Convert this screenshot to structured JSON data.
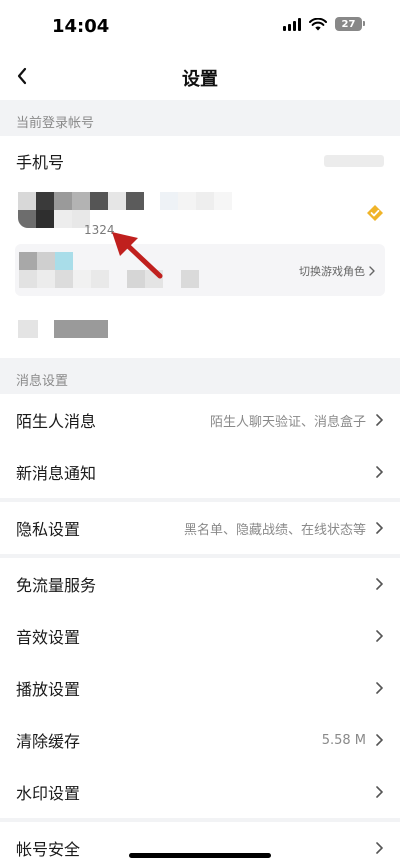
{
  "status_bar": {
    "time": "14:04",
    "battery": "27"
  },
  "nav": {
    "title": "设置",
    "back_icon": "chevron-left-icon"
  },
  "sections": {
    "account_label": "当前登录帐号",
    "message_label": "消息设置"
  },
  "account": {
    "phone_label": "手机号",
    "uid_partial": "1324",
    "switch_role_label": "切换游戏角色"
  },
  "rows": {
    "stranger": {
      "label": "陌生人消息",
      "value": "陌生人聊天验证、消息盒子"
    },
    "new_msg": {
      "label": "新消息通知"
    },
    "privacy": {
      "label": "隐私设置",
      "value": "黑名单、隐藏战绩、在线状态等"
    },
    "free_traffic": {
      "label": "免流量服务"
    },
    "sound": {
      "label": "音效设置"
    },
    "playback": {
      "label": "播放设置"
    },
    "cache": {
      "label": "清除缓存",
      "value": "5.58 M"
    },
    "watermark": {
      "label": "水印设置"
    },
    "security": {
      "label": "帐号安全"
    }
  },
  "colors": {
    "accent_verify": "#f0b429",
    "annotation_arrow": "#c0201e"
  }
}
